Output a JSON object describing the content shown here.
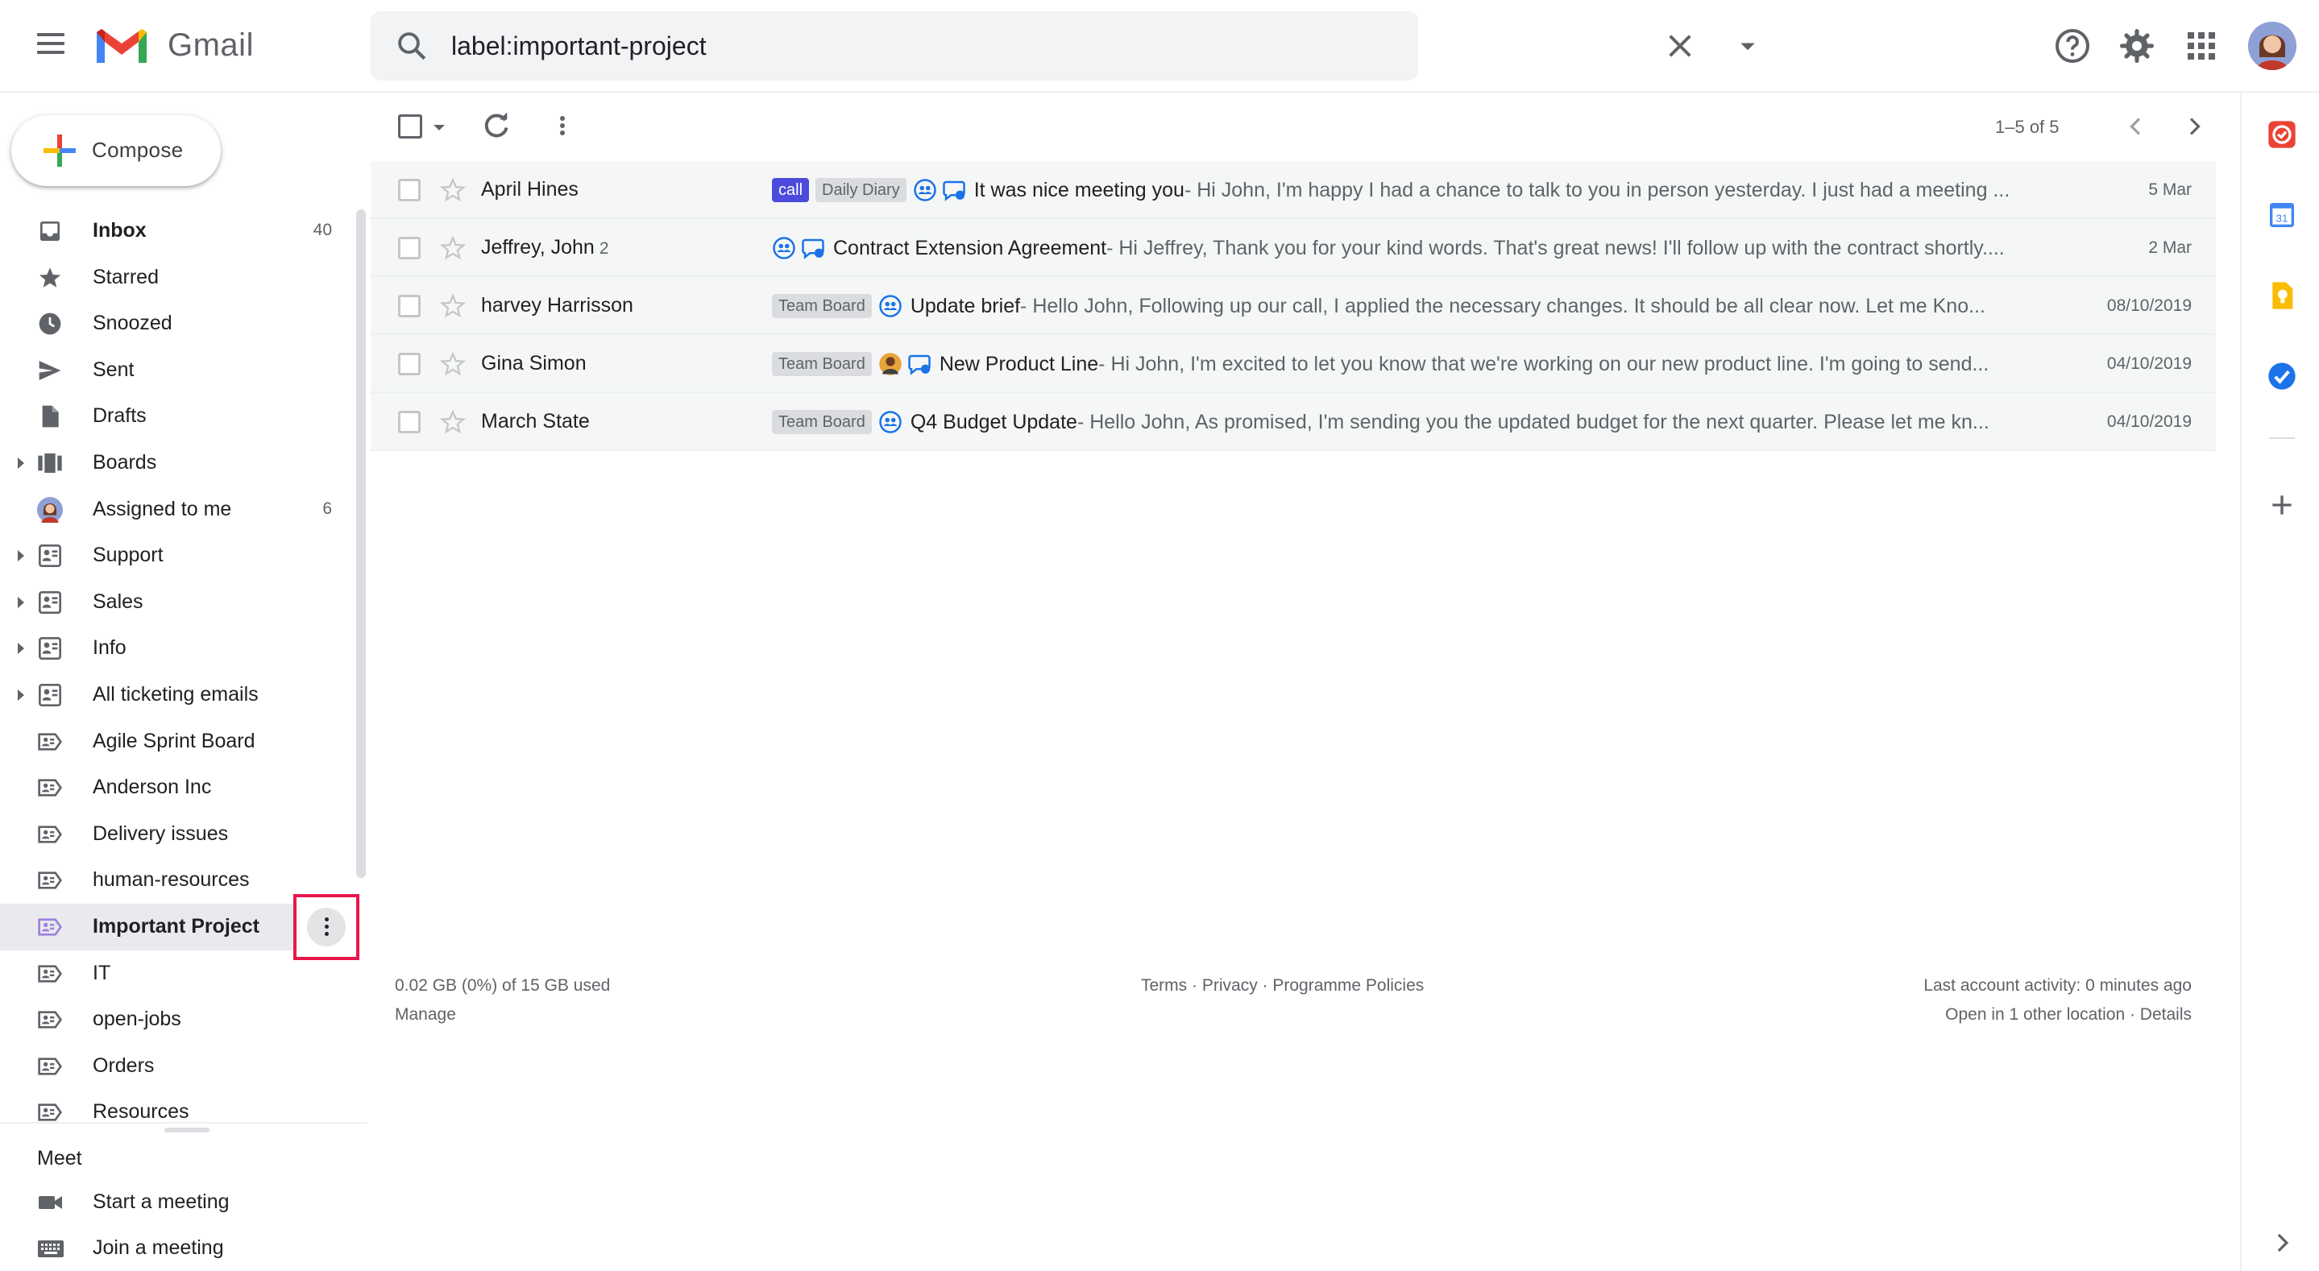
{
  "app": {
    "name": "Gmail"
  },
  "search": {
    "query": "label:important-project"
  },
  "compose": {
    "label": "Compose"
  },
  "nav": {
    "items": [
      {
        "label": "Inbox",
        "count": "40",
        "icon": "inbox-icon",
        "bold": true
      },
      {
        "label": "Starred",
        "count": "",
        "icon": "star-icon"
      },
      {
        "label": "Snoozed",
        "count": "",
        "icon": "clock-icon"
      },
      {
        "label": "Sent",
        "count": "",
        "icon": "send-icon"
      },
      {
        "label": "Drafts",
        "count": "",
        "icon": "draft-icon"
      },
      {
        "label": "Boards",
        "count": "",
        "icon": "boards-icon",
        "expandable": true
      },
      {
        "label": "Assigned to me",
        "count": "6",
        "icon": "avatar-icon"
      },
      {
        "label": "Support",
        "count": "",
        "icon": "shared-label-icon",
        "expandable": true
      },
      {
        "label": "Sales",
        "count": "",
        "icon": "shared-label-icon",
        "expandable": true
      },
      {
        "label": "Info",
        "count": "",
        "icon": "shared-label-icon",
        "expandable": true
      },
      {
        "label": "All ticketing emails",
        "count": "",
        "icon": "shared-label-icon",
        "expandable": true
      },
      {
        "label": "Agile Sprint Board",
        "count": "",
        "icon": "board-label-icon"
      },
      {
        "label": "Anderson Inc",
        "count": "",
        "icon": "board-label-icon"
      },
      {
        "label": "Delivery issues",
        "count": "",
        "icon": "board-label-icon"
      },
      {
        "label": "human-resources",
        "count": "",
        "icon": "board-label-icon"
      },
      {
        "label": "Important Project",
        "count": "",
        "icon": "board-label-icon",
        "bold": true,
        "selected": true
      },
      {
        "label": "IT",
        "count": "",
        "icon": "board-label-icon"
      },
      {
        "label": "open-jobs",
        "count": "",
        "icon": "board-label-icon"
      },
      {
        "label": "Orders",
        "count": "",
        "icon": "board-label-icon"
      },
      {
        "label": "Resources",
        "count": "",
        "icon": "board-label-icon"
      }
    ]
  },
  "meet": {
    "title": "Meet",
    "start": "Start a meeting",
    "join": "Join a meeting"
  },
  "pager": {
    "text": "1–5 of 5"
  },
  "emails": [
    {
      "sender": "April Hines",
      "count": "",
      "labels": [
        {
          "text": "call",
          "style": "call"
        },
        {
          "text": "Daily Diary",
          "style": "grey"
        }
      ],
      "icons": [
        "team-icon",
        "chat-icon"
      ],
      "subject": "It was nice meeting you",
      "snippet": " - Hi John, I'm happy I had a chance to talk to you in person yesterday. I just had a meeting ...",
      "date": "5 Mar"
    },
    {
      "sender": "Jeffrey, John",
      "count": "2",
      "labels": [],
      "icons": [
        "team-icon",
        "chat-icon"
      ],
      "subject": "Contract Extension Agreement",
      "snippet": " - Hi Jeffrey, Thank you for your kind words. That's great news! I'll follow up with the contract shortly....",
      "date": "2 Mar"
    },
    {
      "sender": "harvey Harrisson",
      "count": "",
      "labels": [
        {
          "text": "Team Board",
          "style": "grey"
        }
      ],
      "icons": [
        "team-icon"
      ],
      "subject": "Update brief",
      "snippet": " - Hello John, Following up our call, I applied the necessary changes. It should be all clear now. Let me Kno...",
      "date": "08/10/2019"
    },
    {
      "sender": "Gina Simon",
      "count": "",
      "labels": [
        {
          "text": "Team Board",
          "style": "grey"
        }
      ],
      "icons": [
        "person-avatar-icon",
        "chat-icon"
      ],
      "subject": "New Product Line",
      "snippet": " - Hi John, I'm excited to let you know that we're working on our new product line. I'm going to send...",
      "date": "04/10/2019"
    },
    {
      "sender": "March State",
      "count": "",
      "labels": [
        {
          "text": "Team Board",
          "style": "grey"
        }
      ],
      "icons": [
        "team-icon"
      ],
      "subject": "Q4 Budget Update",
      "snippet": " - Hello John, As promised, I'm sending you the updated budget for the next quarter. Please let me kn...",
      "date": "04/10/2019"
    }
  ],
  "footer": {
    "storage": "0.02 GB (0%) of 15 GB used",
    "manage": "Manage",
    "terms": "Terms",
    "privacy": "Privacy",
    "policies": "Programme Policies",
    "sep": " · ",
    "activity": "Last account activity: 0 minutes ago",
    "other_location": "Open in 1 other location",
    "details": "Details"
  },
  "colors": {
    "accent_selected": "#e8eaed",
    "highlight_box": "#e8174b",
    "call_label": "#4d4bdc"
  }
}
